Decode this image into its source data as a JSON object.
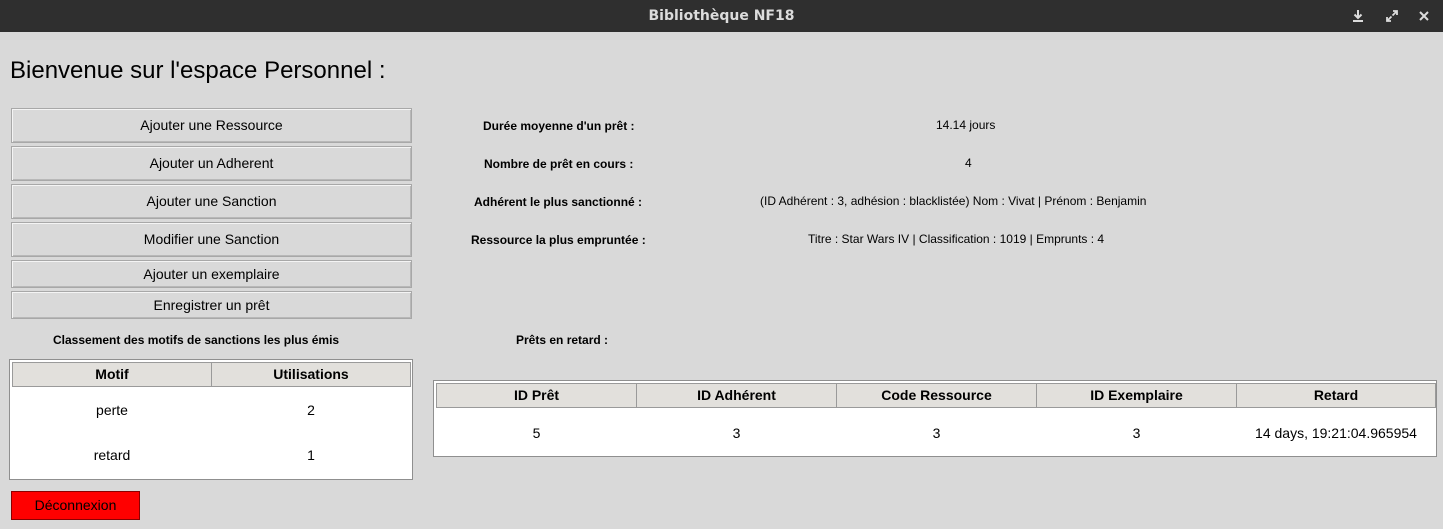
{
  "window": {
    "title": "Bibliothèque NF18",
    "controls": [
      "download-icon",
      "maximize-icon",
      "close-icon"
    ]
  },
  "heading": "Bienvenue sur l'espace Personnel :",
  "actions": {
    "add_resource": "Ajouter une Ressource",
    "add_member": "Ajouter un Adherent",
    "add_sanction": "Ajouter une Sanction",
    "edit_sanction": "Modifier une Sanction",
    "add_copy": "Ajouter un exemplaire",
    "register_loan": "Enregistrer un prêt"
  },
  "stats": {
    "avg_loan_label": "Durée moyenne d'un prêt :",
    "avg_loan_value": "14.14 jours",
    "ongoing_label": "Nombre de prêt en cours :",
    "ongoing_value": "4",
    "most_sanctioned_label": "Adhérent le plus sanctionné :",
    "most_sanctioned_value": "(ID Adhérent : 3, adhésion : blacklistée) Nom : Vivat |  Prénom : Benjamin",
    "most_borrowed_label": "Ressource la plus empruntée :",
    "most_borrowed_value": "Titre : Star Wars IV |  Classification : 1019 |  Emprunts : 4"
  },
  "sanctions_ranking": {
    "title": "Classement des motifs de sanctions les plus émis",
    "headers": [
      "Motif",
      "Utilisations"
    ],
    "rows": [
      [
        "perte",
        "2"
      ],
      [
        "retard",
        "1"
      ]
    ]
  },
  "late_loans": {
    "title": "Prêts en retard :",
    "headers": [
      "ID Prêt",
      "ID Adhérent",
      "Code Ressource",
      "ID Exemplaire",
      "Retard"
    ],
    "rows": [
      [
        "5",
        "3",
        "3",
        "3",
        "14 days, 19:21:04.965954"
      ]
    ]
  },
  "logout_label": "Déconnexion",
  "colors": {
    "titlebar": "#2f2f2f",
    "background": "#d9d9d9",
    "logout_button": "#ff0000"
  }
}
